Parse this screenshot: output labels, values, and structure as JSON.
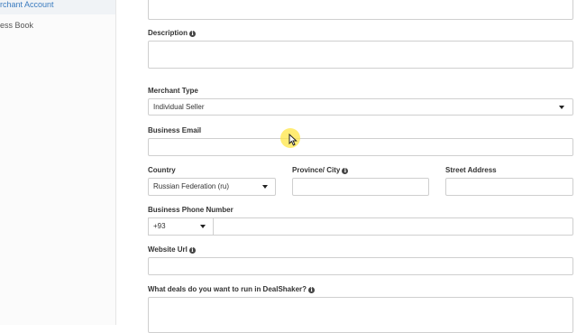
{
  "sidebar": {
    "items": [
      {
        "label": "Merchant Account",
        "visible_text": "rchant Account",
        "active": true
      },
      {
        "label": "Address Book",
        "visible_text": "ess Book",
        "active": false
      }
    ]
  },
  "form": {
    "description": {
      "label": "Description",
      "value": ""
    },
    "merchant_type": {
      "label": "Merchant Type",
      "selected": "Individual Seller"
    },
    "business_email": {
      "label": "Business Email",
      "value": ""
    },
    "country": {
      "label": "Country",
      "selected": "Russian Federation (ru)"
    },
    "province_city": {
      "label": "Province/ City",
      "value": ""
    },
    "street_address": {
      "label": "Street Address",
      "value": ""
    },
    "business_phone": {
      "label": "Business Phone Number",
      "code": "+93",
      "value": ""
    },
    "website_url": {
      "label": "Website Url",
      "value": ""
    },
    "deals": {
      "label": "What deals do you want to run in DealShaker?",
      "value": ""
    }
  },
  "icons": {
    "info": "info-circle-icon",
    "dropdown": "caret-down-icon",
    "cursor": "mouse-pointer-icon"
  },
  "colors": {
    "sidebar_active_text": "#3a7bbf",
    "border": "#cfcfcf",
    "cursor_highlight": "#ffe646"
  }
}
